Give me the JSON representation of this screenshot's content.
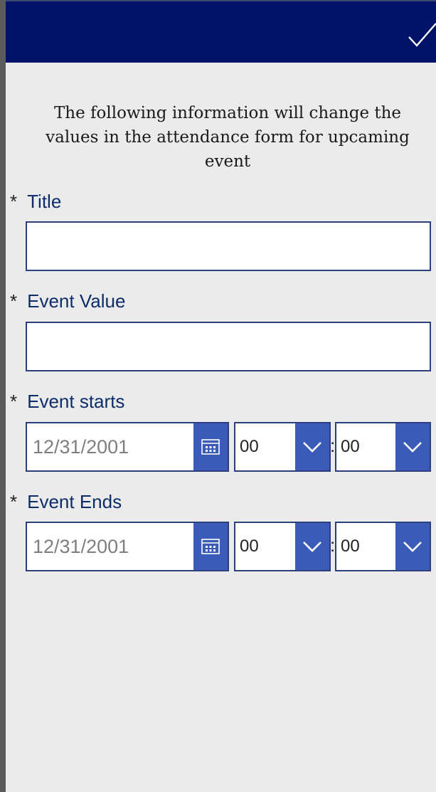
{
  "header": {
    "confirm_icon": "checkmark-icon"
  },
  "intro_text": "The following information will change the values in the attendance form for upcaming event",
  "form": {
    "required_marker": "*",
    "title": {
      "label": "Title",
      "value": ""
    },
    "event_value": {
      "label": "Event Value",
      "value": ""
    },
    "event_starts": {
      "label": "Event starts",
      "date": "12/31/2001",
      "hour": "00",
      "separator": ":",
      "minute": "00"
    },
    "event_ends": {
      "label": "Event Ends",
      "date": "12/31/2001",
      "hour": "00",
      "separator": ":",
      "minute": "00"
    }
  },
  "colors": {
    "header_bg": "#001368",
    "accent": "#3a5cb8",
    "label": "#0c2d69",
    "border": "#2a3f7c"
  }
}
